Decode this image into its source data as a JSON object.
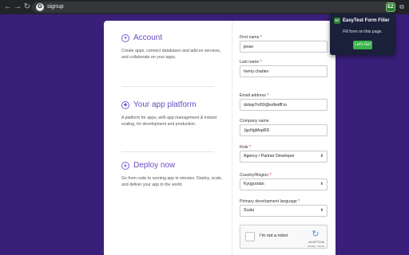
{
  "browser": {
    "back_icon": "←",
    "forward_icon": "→",
    "reload_icon": "↻",
    "site_icon": "G",
    "url": "signup",
    "extension_icon": "EZ",
    "puzzle_icon": "⧉"
  },
  "background": {
    "color": "#3a1f7a",
    "watermark": "\\\\\\ ///"
  },
  "info": {
    "sections": [
      {
        "icon": "user-icon",
        "title": "Account",
        "desc": "Create apps, connect databases and add-on services, and collaborate on your apps."
      },
      {
        "icon": "platform-icon",
        "title": "Your app platform",
        "desc": "A platform for apps, with app management & instant scaling, for development and production."
      },
      {
        "icon": "deploy-icon",
        "title": "Deploy now",
        "desc": "Go from code to running app in minutes. Deploy, scale, and deliver your app to the world."
      }
    ]
  },
  "form": {
    "first_name": {
      "label": "First name",
      "value": "jesse",
      "required": "*"
    },
    "last_name": {
      "label": "Last name",
      "value": "henry charles",
      "required": "*"
    },
    "email": {
      "label": "Email address",
      "value": "dztwp7rri59@ezfwdff.io",
      "required": "*"
    },
    "company": {
      "label": "Company name",
      "value": "JgcNgMopRD",
      "required": ""
    },
    "role": {
      "label": "Role",
      "value": "Agency / Partner Developer",
      "required": "*"
    },
    "country": {
      "label": "Country/Region",
      "value": "Kyrgyzstan",
      "required": "*"
    },
    "language": {
      "label": "Primary development language",
      "value": "Scala",
      "required": "*"
    },
    "caret": "⬍"
  },
  "captcha": {
    "label": "I'm not a robot",
    "logo": "↻",
    "brand": "reCAPTCHA",
    "links": "Privacy - Terms"
  },
  "popup": {
    "logo": "EZ",
    "title": "EasyTest Form Filler",
    "subtitle": "Fill form on this page.",
    "button": "Let's Go!",
    "accent": "#3bb54a"
  }
}
